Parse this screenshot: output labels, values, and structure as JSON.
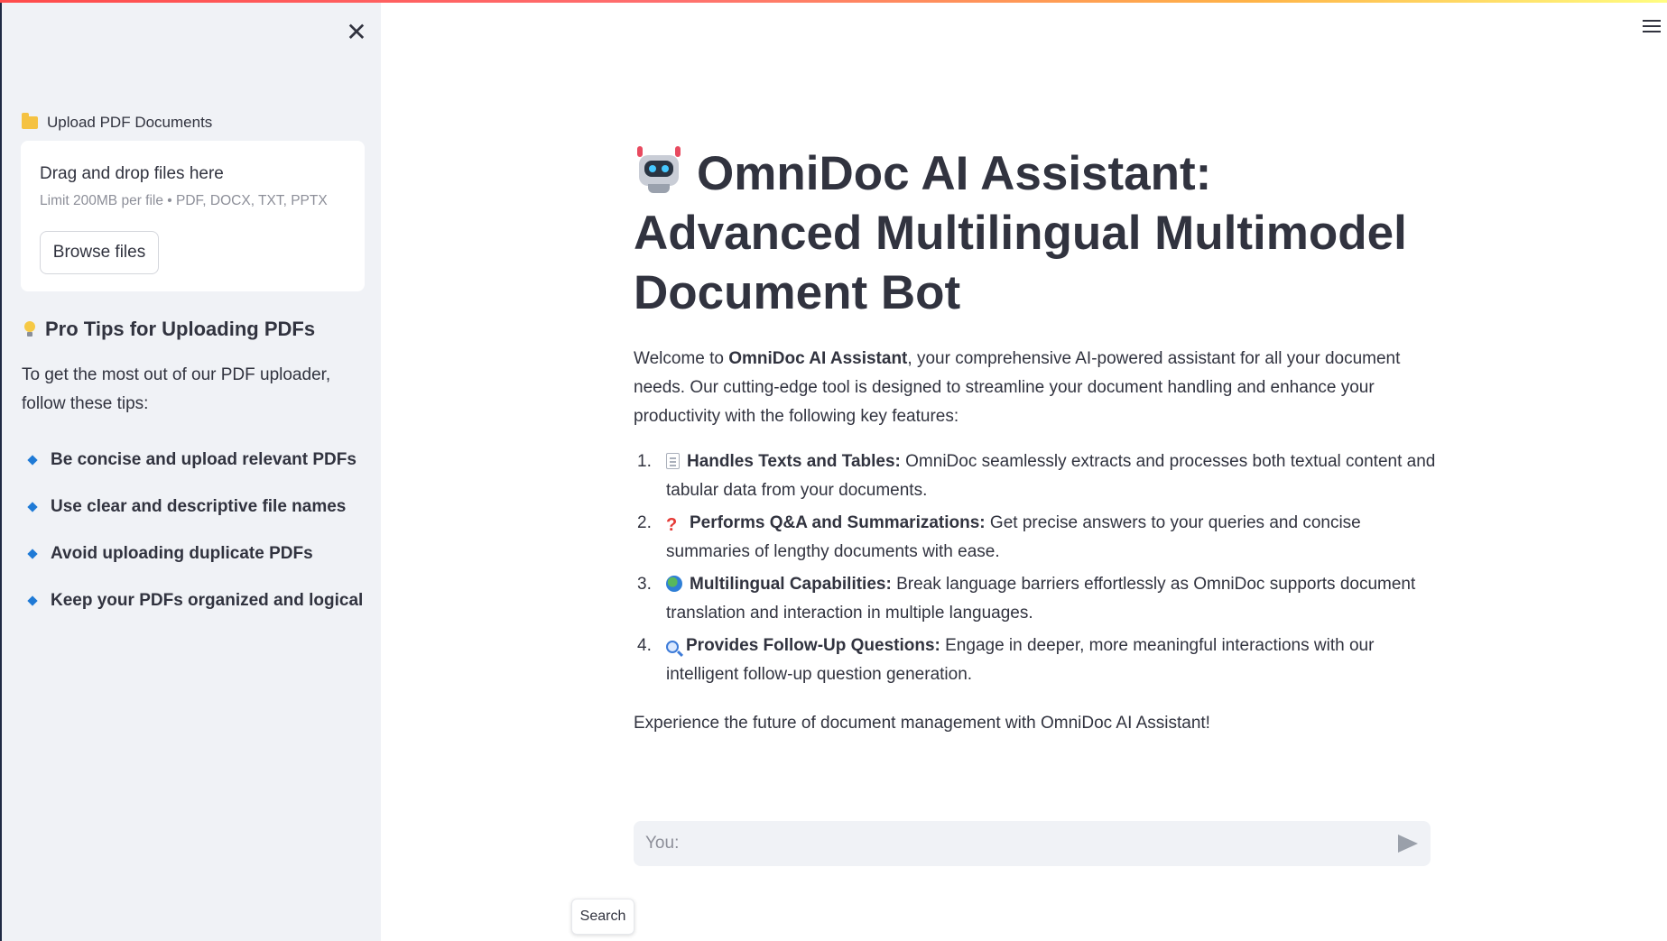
{
  "sidebar": {
    "close_label": "✕",
    "upload_label": "Upload PDF Documents",
    "dropzone": {
      "title": "Drag and drop files here",
      "subtitle": "Limit 200MB per file • PDF, DOCX, TXT, PPTX",
      "browse_label": "Browse files"
    },
    "tips_heading": "Pro Tips for Uploading PDFs",
    "tips_intro": "To get the most out of our PDF uploader, follow these tips:",
    "tips": [
      "Be concise and upload relevant PDFs",
      "Use clear and descriptive file names",
      "Avoid uploading duplicate PDFs",
      "Keep your PDFs organized and logical"
    ]
  },
  "main": {
    "title": "OmniDoc AI Assistant: Advanced Multilingual Multimodel Document Bot",
    "intro": {
      "prefix": "Welcome to ",
      "brand": "OmniDoc AI Assistant",
      "suffix": ", your comprehensive AI-powered assistant for all your document needs. Our cutting-edge tool is designed to streamline your document handling and enhance your productivity with the following key features:"
    },
    "features": [
      {
        "num": "1.",
        "icon": "page-icon",
        "title": "Handles Texts and Tables:",
        "text": " OmniDoc seamlessly extracts and processes both textual content and tabular data from your documents."
      },
      {
        "num": "2.",
        "icon": "question-icon",
        "title": "Performs Q&A and Summarizations:",
        "text": " Get precise answers to your queries and concise summaries of lengthy documents with ease."
      },
      {
        "num": "3.",
        "icon": "globe-icon",
        "title": "Multilingual Capabilities:",
        "text": " Break language barriers effortlessly as OmniDoc supports document translation and interaction in multiple languages."
      },
      {
        "num": "4.",
        "icon": "magnifier-icon",
        "title": "Provides Follow-Up Questions:",
        "text": " Engage in deeper, more meaningful interactions with our intelligent follow-up question generation."
      }
    ],
    "outro": "Experience the future of document management with OmniDoc AI Assistant!",
    "chat": {
      "placeholder": "You:"
    },
    "search_label": "Search"
  },
  "colors": {
    "sidebar_bg": "#f0f2f6",
    "text": "#31333f",
    "bullet": "#1f7ad6"
  }
}
